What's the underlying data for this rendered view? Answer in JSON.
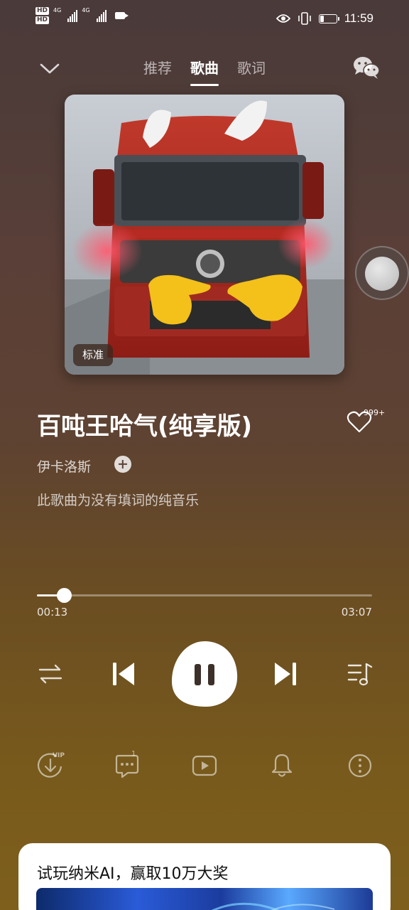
{
  "status": {
    "time": "11:59",
    "network_labels": [
      "4G",
      "4G"
    ],
    "hd_labels": [
      "HD",
      "HD"
    ],
    "battery_level": 0.3
  },
  "header": {
    "tabs": [
      {
        "label": "推荐",
        "active": false
      },
      {
        "label": "歌曲",
        "active": true
      },
      {
        "label": "歌词",
        "active": false
      }
    ]
  },
  "album": {
    "quality": "标准",
    "art_description": "red-truck-cover"
  },
  "song": {
    "title": "百吨王哈气(纯享版)",
    "artist": "伊卡洛斯",
    "lyric_note": "此歌曲为没有填词的纯音乐",
    "like_count": "999+"
  },
  "playback": {
    "current": "00:13",
    "total": "03:07",
    "progress": 0.0807,
    "state": "playing"
  },
  "actions": {
    "download_tag": "VIP",
    "comment_count": "1",
    "icons": [
      "vip-download-icon",
      "comment-icon",
      "video-icon",
      "bell-icon",
      "more-icon"
    ]
  },
  "promo": {
    "title": "试玩纳米AI，赢取10万大奖"
  },
  "colors": {
    "accent": "#ffffff",
    "background_top": "#4a3a3a",
    "background_bottom": "#7e5f1c"
  }
}
